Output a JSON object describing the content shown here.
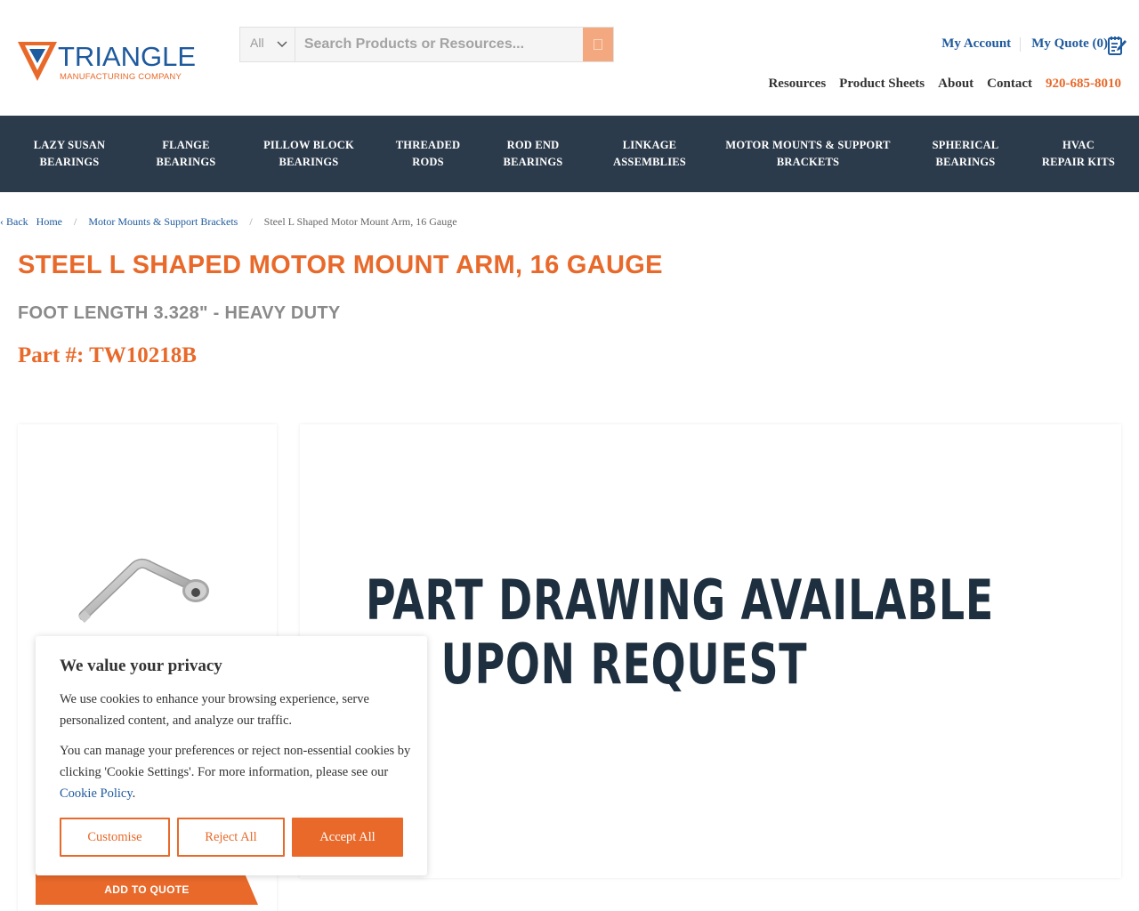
{
  "header": {
    "logo": {
      "name": "TRIANGLE",
      "sub": "MANUFACTURING COMPANY"
    },
    "search": {
      "category": "All",
      "placeholder": "Search Products or Resources..."
    },
    "account_label": "My Account",
    "quote_label": "My Quote (0)",
    "links": [
      "Resources",
      "Product Sheets",
      "About",
      "Contact"
    ],
    "phone": "920-685-8010"
  },
  "nav": [
    {
      "line1": "LAZY SUSAN",
      "line2": "BEARINGS"
    },
    {
      "line1": "FLANGE",
      "line2": "BEARINGS"
    },
    {
      "line1": "PILLOW BLOCK",
      "line2": "BEARINGS"
    },
    {
      "line1": "THREADED",
      "line2": "RODS"
    },
    {
      "line1": "ROD END",
      "line2": "BEARINGS"
    },
    {
      "line1": "LINKAGE",
      "line2": "ASSEMBLIES"
    },
    {
      "line1": "MOTOR MOUNTS & SUPPORT",
      "line2": "BRACKETS"
    },
    {
      "line1": "SPHERICAL",
      "line2": "BEARINGS"
    },
    {
      "line1": "HVAC",
      "line2": "REPAIR KITS"
    }
  ],
  "breadcrumb": {
    "back": "‹  Back",
    "home": "Home",
    "category": "Motor Mounts & Support Brackets",
    "current": "Steel L Shaped Motor Mount Arm, 16 Gauge"
  },
  "product": {
    "title": "STEEL L SHAPED MOTOR MOUNT ARM, 16 GAUGE",
    "subtitle": "FOOT LENGTH 3.328\" - HEAVY DUTY",
    "part_number": "Part #: TW10218B",
    "add_to_quote": "ADD TO QUOTE",
    "drawing_line1": "PART DRAWING AVAILABLE",
    "drawing_line2": "UPON REQUEST"
  },
  "cookie": {
    "title": "We value your privacy",
    "p1": "We use cookies to enhance your browsing experience, serve personalized content, and analyze our traffic.",
    "p2": "You can manage your preferences or reject non-essential cookies by clicking 'Cookie Settings'. For more information, please see our",
    "link": "Cookie Policy",
    "link_suffix": ".",
    "customise": "Customise",
    "reject": "Reject All",
    "accept": "Accept All"
  },
  "colors": {
    "brand_orange": "#e8692a",
    "brand_blue": "#1e5a9e",
    "nav_bg": "#2c3b4b"
  }
}
